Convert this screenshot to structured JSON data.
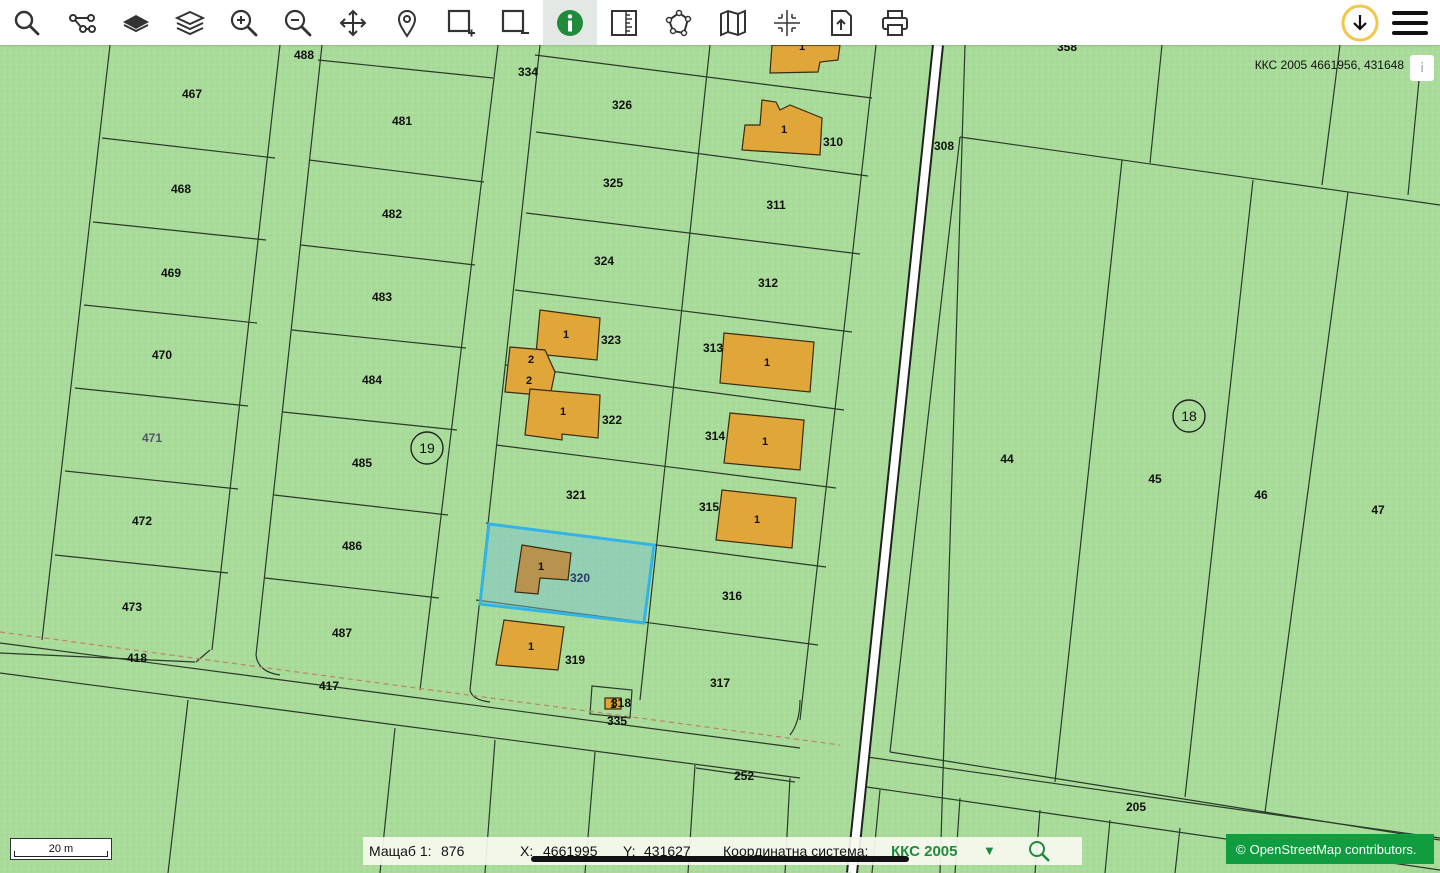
{
  "toolbar": {
    "tools": [
      {
        "name": "search-tool",
        "icon": "search-icon"
      },
      {
        "name": "network-tool",
        "icon": "network-icon"
      },
      {
        "name": "base-layer-tool",
        "icon": "layer-single-icon"
      },
      {
        "name": "layers-tool",
        "icon": "layers-icon"
      },
      {
        "name": "zoom-in-tool",
        "icon": "zoom-in-icon"
      },
      {
        "name": "zoom-out-tool",
        "icon": "zoom-out-icon"
      },
      {
        "name": "pan-tool",
        "icon": "move-icon"
      },
      {
        "name": "location-tool",
        "icon": "pin-icon"
      },
      {
        "name": "add-area-tool",
        "icon": "square-plus-icon"
      },
      {
        "name": "remove-area-tool",
        "icon": "square-minus-icon"
      },
      {
        "name": "info-tool",
        "icon": "info-icon",
        "active": true
      },
      {
        "name": "measure-tool",
        "icon": "ruler-icon"
      },
      {
        "name": "polygon-tool",
        "icon": "polygon-icon"
      },
      {
        "name": "map-tool",
        "icon": "map-icon"
      },
      {
        "name": "coordinates-tool",
        "icon": "crosshair-icon"
      },
      {
        "name": "export-tool",
        "icon": "export-icon"
      },
      {
        "name": "print-tool",
        "icon": "print-icon"
      }
    ],
    "download_icon": "download-icon",
    "menu_icon": "menu-icon"
  },
  "coord_readout": "ККС 2005 4661956, 431648",
  "map": {
    "parcels": [
      "488",
      "467",
      "481",
      "334",
      "326",
      "310",
      "468",
      "482",
      "325",
      "311",
      "308",
      "469",
      "483",
      "324",
      "312",
      "470",
      "484",
      "323",
      "313",
      "471",
      "322",
      "314",
      "485",
      "321",
      "315",
      "472",
      "486",
      "320",
      "316",
      "473",
      "487",
      "319",
      "317",
      "418",
      "417",
      "318",
      "335",
      "252",
      "205",
      "44",
      "45",
      "46",
      "47",
      "358"
    ],
    "building_labels": [
      "1",
      "2",
      "2",
      "1",
      "1",
      "1",
      "1",
      "1",
      "1",
      "1",
      "1",
      "1"
    ],
    "block_labels": [
      "19",
      "18"
    ],
    "selected_parcel": "320"
  },
  "scalebar": {
    "label": "20 m"
  },
  "status": {
    "scale_label": "Мащаб 1:",
    "scale_value": "876",
    "x_label": "X:",
    "x_value": "4661995",
    "y_label": "Y:",
    "y_value": "431627",
    "crs_label": "Координатна система:",
    "crs_value": "ККС 2005"
  },
  "attribution": {
    "symbol": "©",
    "text": "OpenStreetMap contributors."
  },
  "colors": {
    "land": "#a9dc9a",
    "building": "#e1a63a",
    "selection": "#33b4e6",
    "active_tool": "#1f8a3c",
    "osm_badge": "#0f9d3f"
  }
}
